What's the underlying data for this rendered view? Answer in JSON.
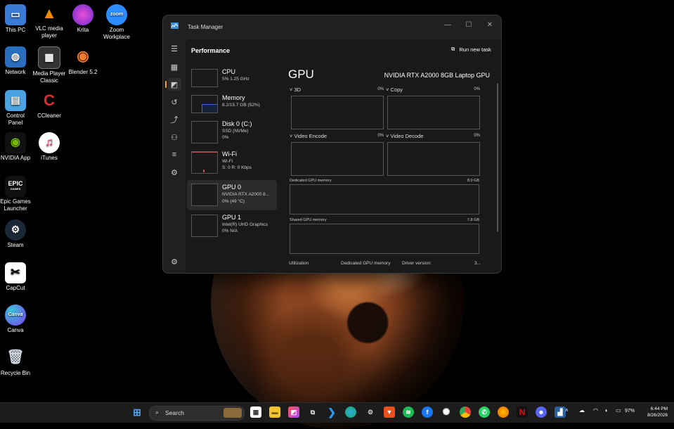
{
  "desktop": {
    "icons": [
      {
        "label": "This PC"
      },
      {
        "label": "VLC media player"
      },
      {
        "label": "Krita"
      },
      {
        "label": "Zoom Workplace"
      },
      {
        "label": "Network"
      },
      {
        "label": "Media Player Classic"
      },
      {
        "label": "Blender 5.2"
      },
      {
        "label": "Control Panel"
      },
      {
        "label": "CCleaner"
      },
      {
        "label": "NVIDIA App"
      },
      {
        "label": "iTunes"
      },
      {
        "label": "Epic Games Launcher"
      },
      {
        "label": "Steam"
      },
      {
        "label": "CapCut"
      },
      {
        "label": "Canva"
      },
      {
        "label": "Recycle Bin"
      }
    ],
    "zoom_glyph": "zoom",
    "canva_glyph": "Canva",
    "epic_glyph": "EPIC",
    "epic_sub": "GAMES"
  },
  "task_manager": {
    "title": "Task Manager",
    "section": "Performance",
    "run_new_task": "Run new task",
    "more": "···",
    "window_controls": {
      "minimize": "—",
      "maximize": "☐",
      "close": "✕"
    },
    "accent_color": "#f0a33a",
    "devices": [
      {
        "name": "CPU",
        "line1": "5%  1.25 GHz",
        "line2": ""
      },
      {
        "name": "Memory",
        "line1": "8.2/15.7 GB (52%)",
        "line2": ""
      },
      {
        "name": "Disk 0 (C:)",
        "line1": "SSD (NVMe)",
        "line2": "0%"
      },
      {
        "name": "Wi-Fi",
        "line1": "Wi-Fi",
        "line2": "S: 0 R: 0 Kbps"
      },
      {
        "name": "GPU 0",
        "line1": "NVIDIA RTX A2000 8...",
        "line2": "0%  (49 °C)"
      },
      {
        "name": "GPU 1",
        "line1": "Intel(R) UHD Graphics",
        "line2": "0%  N/A"
      }
    ],
    "selected_device": "GPU 0",
    "gpu": {
      "title": "GPU",
      "model": "NVIDIA RTX A2000 8GB Laptop GPU",
      "engines": [
        {
          "label": "3D",
          "percent": "0%"
        },
        {
          "label": "Copy",
          "percent": "0%"
        },
        {
          "label": "Video Encode",
          "percent": "0%"
        },
        {
          "label": "Video Decode",
          "percent": "0%"
        }
      ],
      "dedicated_memory": {
        "label": "Dedicated GPU memory",
        "value": "8.0 GB"
      },
      "shared_memory": {
        "label": "Shared GPU memory",
        "value": "7.8 GB"
      },
      "footer": {
        "utilization": "Utilization",
        "dedicated": "Dedicated GPU memory",
        "driver": "Driver version:",
        "driver_value": "3..."
      }
    }
  },
  "taskbar": {
    "search_placeholder": "Search",
    "battery": "97%",
    "time": "6:44 PM",
    "date": "8/26/2026"
  }
}
